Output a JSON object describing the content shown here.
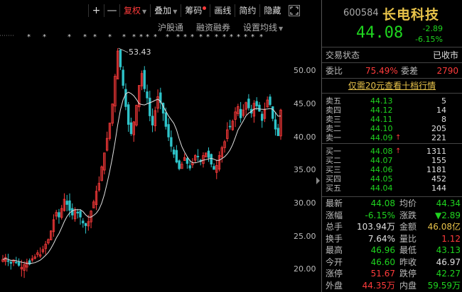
{
  "toolbar": {
    "plus": "+",
    "minus": "—",
    "fq": "复权",
    "overlay": "叠加",
    "chips": "筹码",
    "draw": "画线",
    "summary": "简约",
    "hide": "隐藏"
  },
  "subtoolbar": {
    "hgt": "沪股通",
    "margin": "融资融券",
    "ma": "设置均线"
  },
  "chart": {
    "peak_label": "53.43",
    "yticks": [
      "50.00",
      "45.00",
      "40.00",
      "35.00",
      "30.00",
      "25.00",
      "20.00"
    ]
  },
  "chart_data": {
    "type": "candlestick",
    "title": "",
    "ylim": [
      18.5,
      55.5
    ],
    "yticks": [
      50,
      45,
      40,
      35,
      30,
      25,
      20
    ],
    "peak": 53.43,
    "close_series": [
      21.5,
      21.8,
      21.2,
      20.9,
      21.4,
      21.0,
      20.6,
      20.3,
      20.7,
      21.1,
      20.8,
      21.6,
      21.9,
      22.5,
      22.2,
      23.0,
      23.8,
      24.5,
      25.8,
      27.5,
      28.6,
      27.9,
      29.2,
      30.6,
      29.8,
      28.9,
      28.2,
      29.0,
      28.5,
      27.9,
      27.0,
      26.6,
      27.2,
      28.8,
      30.2,
      31.8,
      33.0,
      35.5,
      37.6,
      39.8,
      42.1,
      45.0,
      49.2,
      53.0,
      50.6,
      47.8,
      44.6,
      41.9,
      40.5,
      42.3,
      44.8,
      47.8,
      49.6,
      47.3,
      45.9,
      43.2,
      41.8,
      44.0,
      46.1,
      45.2,
      43.6,
      41.6,
      40.0,
      38.6,
      37.4,
      36.2,
      35.2,
      35.9,
      36.9,
      36.0,
      35.3,
      36.1,
      37.2,
      37.0,
      36.3,
      37.2,
      37.6,
      36.9,
      35.9,
      35.1,
      35.7,
      37.2,
      38.4,
      39.3,
      41.1,
      41.6,
      42.4,
      43.8,
      44.6,
      42.9,
      44.1,
      45.2,
      44.4,
      43.6,
      45.1,
      44.7,
      43.9,
      42.5,
      44.1,
      45.6,
      44.9,
      42.8,
      41.2,
      40.2,
      44.08
    ]
  },
  "quote": {
    "code": "600584",
    "name": "长电科技",
    "price": "44.08",
    "change": "-2.89",
    "pct": "-6.15%"
  },
  "status": {
    "label": "交易状态",
    "value": "已收市"
  },
  "ratio": {
    "wb_label": "委比",
    "wb_value": "75.49%",
    "wc_label": "委差",
    "wc_value": "2790"
  },
  "hint": "仅需20元查看十档行情",
  "asks": [
    {
      "label": "卖五",
      "price": "44.13",
      "vol": "5"
    },
    {
      "label": "卖四",
      "price": "44.12",
      "vol": "14"
    },
    {
      "label": "卖三",
      "price": "44.11",
      "vol": "8"
    },
    {
      "label": "卖二",
      "price": "44.10",
      "vol": "205"
    },
    {
      "label": "卖一",
      "price": "44.09",
      "vol": "221",
      "arrow": "↑"
    }
  ],
  "bids": [
    {
      "label": "买一",
      "price": "44.08",
      "vol": "1311",
      "arrow": "↑"
    },
    {
      "label": "买二",
      "price": "44.07",
      "vol": "155"
    },
    {
      "label": "买三",
      "price": "44.06",
      "vol": "1181"
    },
    {
      "label": "买四",
      "price": "44.05",
      "vol": "452"
    },
    {
      "label": "买五",
      "price": "44.04",
      "vol": "144"
    }
  ],
  "stats": [
    {
      "l1": "最新",
      "v1": "44.08",
      "c1": "green",
      "l2": "均价",
      "v2": "44.34",
      "c2": "green"
    },
    {
      "l1": "涨幅",
      "v1": "-6.15%",
      "c1": "green",
      "l2": "涨跌",
      "v2": "▼2.89",
      "c2": "green"
    },
    {
      "l1": "总手",
      "v1": "103.94万",
      "c1": "white",
      "l2": "金额",
      "v2": "46.08亿",
      "c2": "yellow"
    },
    {
      "l1": "换手",
      "v1": "7.64%",
      "c1": "white",
      "l2": "量比",
      "v2": "1.12",
      "c2": "red"
    },
    {
      "l1": "最高",
      "v1": "46.96",
      "c1": "green",
      "l2": "最低",
      "v2": "43.13",
      "c2": "green"
    },
    {
      "l1": "今开",
      "v1": "46.60",
      "c1": "green",
      "l2": "昨收",
      "v2": "46.97",
      "c2": "white"
    },
    {
      "l1": "涨停",
      "v1": "51.67",
      "c1": "red",
      "l2": "跌停",
      "v2": "42.27",
      "c2": "green"
    },
    {
      "l1": "外盘",
      "v1": "44.35万",
      "c1": "red",
      "l2": "内盘",
      "v2": "59.59万",
      "c2": "green"
    }
  ],
  "colors": {
    "up": "#ff3b3b",
    "down": "#1fd51f",
    "ma": "#e0e0e0",
    "down_candle": "#2ec3c9",
    "name": "#e8c34a"
  }
}
